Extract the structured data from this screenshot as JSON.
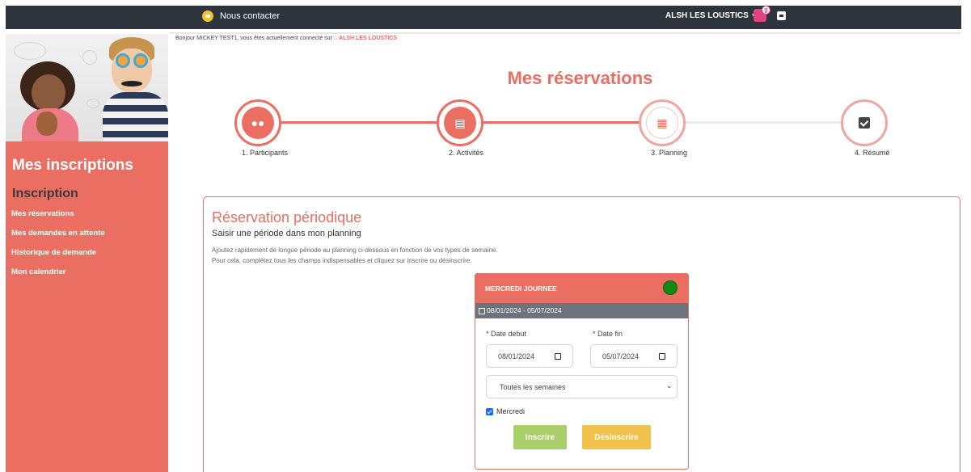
{
  "topbar": {
    "contact_label": "Nous contacter",
    "org_menu_label": "ALSH LES LOUSTICS",
    "cart_count": "0"
  },
  "greeting": {
    "prefix": "Bonjour MICKEY TEST1, vous êtes actuellement connecté sur",
    "org": "ALSH LES LOUSTICS"
  },
  "sidebar": {
    "title": "Mes inscriptions",
    "subtitle": "Inscription",
    "links": [
      {
        "label": "Mes réservations"
      },
      {
        "label": "Mes demandes en attente"
      },
      {
        "label": "Historique de demande"
      },
      {
        "label": "Mon calendrier"
      }
    ]
  },
  "main": {
    "title": "Mes réservations",
    "steps": [
      {
        "label": "1. Participants",
        "icon": "users-icon"
      },
      {
        "label": "2. Activités",
        "icon": "book-icon"
      },
      {
        "label": "3. Planning",
        "icon": "calendar-icon"
      },
      {
        "label": "4. Résumé",
        "icon": "check-square-icon"
      }
    ]
  },
  "panel": {
    "title": "Réservation périodique",
    "subtitle": "Saisir une période dans mon planning",
    "desc_line1": "Ajoutez rapidement de longue période au planning ci-dessous en fonction de vos types de semaine.",
    "desc_line2": "Pour cela, complétez tous les champs indispensables et cliquez sur inscrire ou désinscrire."
  },
  "card": {
    "title": "MERCREDI JOURNEE",
    "date_range": "08/01/2024 - 05/07/2024",
    "date_start_label": "* Date debut",
    "date_end_label": "* Date fin",
    "date_start_value": "08/01/2024",
    "date_end_value": "05/07/2024",
    "week_select_value": "Toutes les semaines",
    "day_checkbox_label": "Mercredi",
    "inscrire_label": "Inscrire",
    "desinscrire_label": "Désinscrire",
    "status_color": "#128a12"
  },
  "colors": {
    "accent": "#ea6e62",
    "topbar": "#2e343b"
  }
}
